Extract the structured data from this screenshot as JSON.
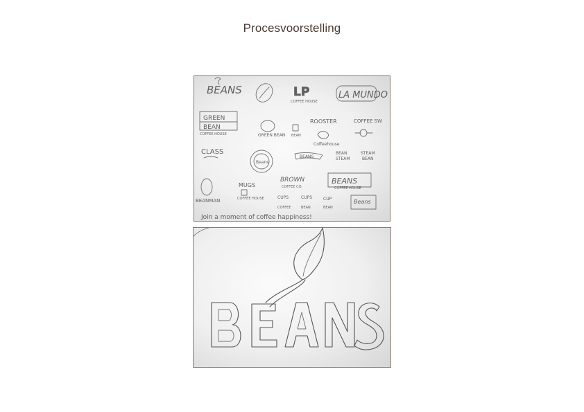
{
  "page": {
    "title": "Procesvoorstelling"
  },
  "images": [
    {
      "kind": "photo",
      "subject": "pencil sketch sheet with multiple logo concepts",
      "caption_handwritten": "Join a moment of coffee happiness!"
    },
    {
      "kind": "photo",
      "subject": "pencil sketch of BEANS logo with leaf",
      "wordmark": "BEANS"
    }
  ]
}
